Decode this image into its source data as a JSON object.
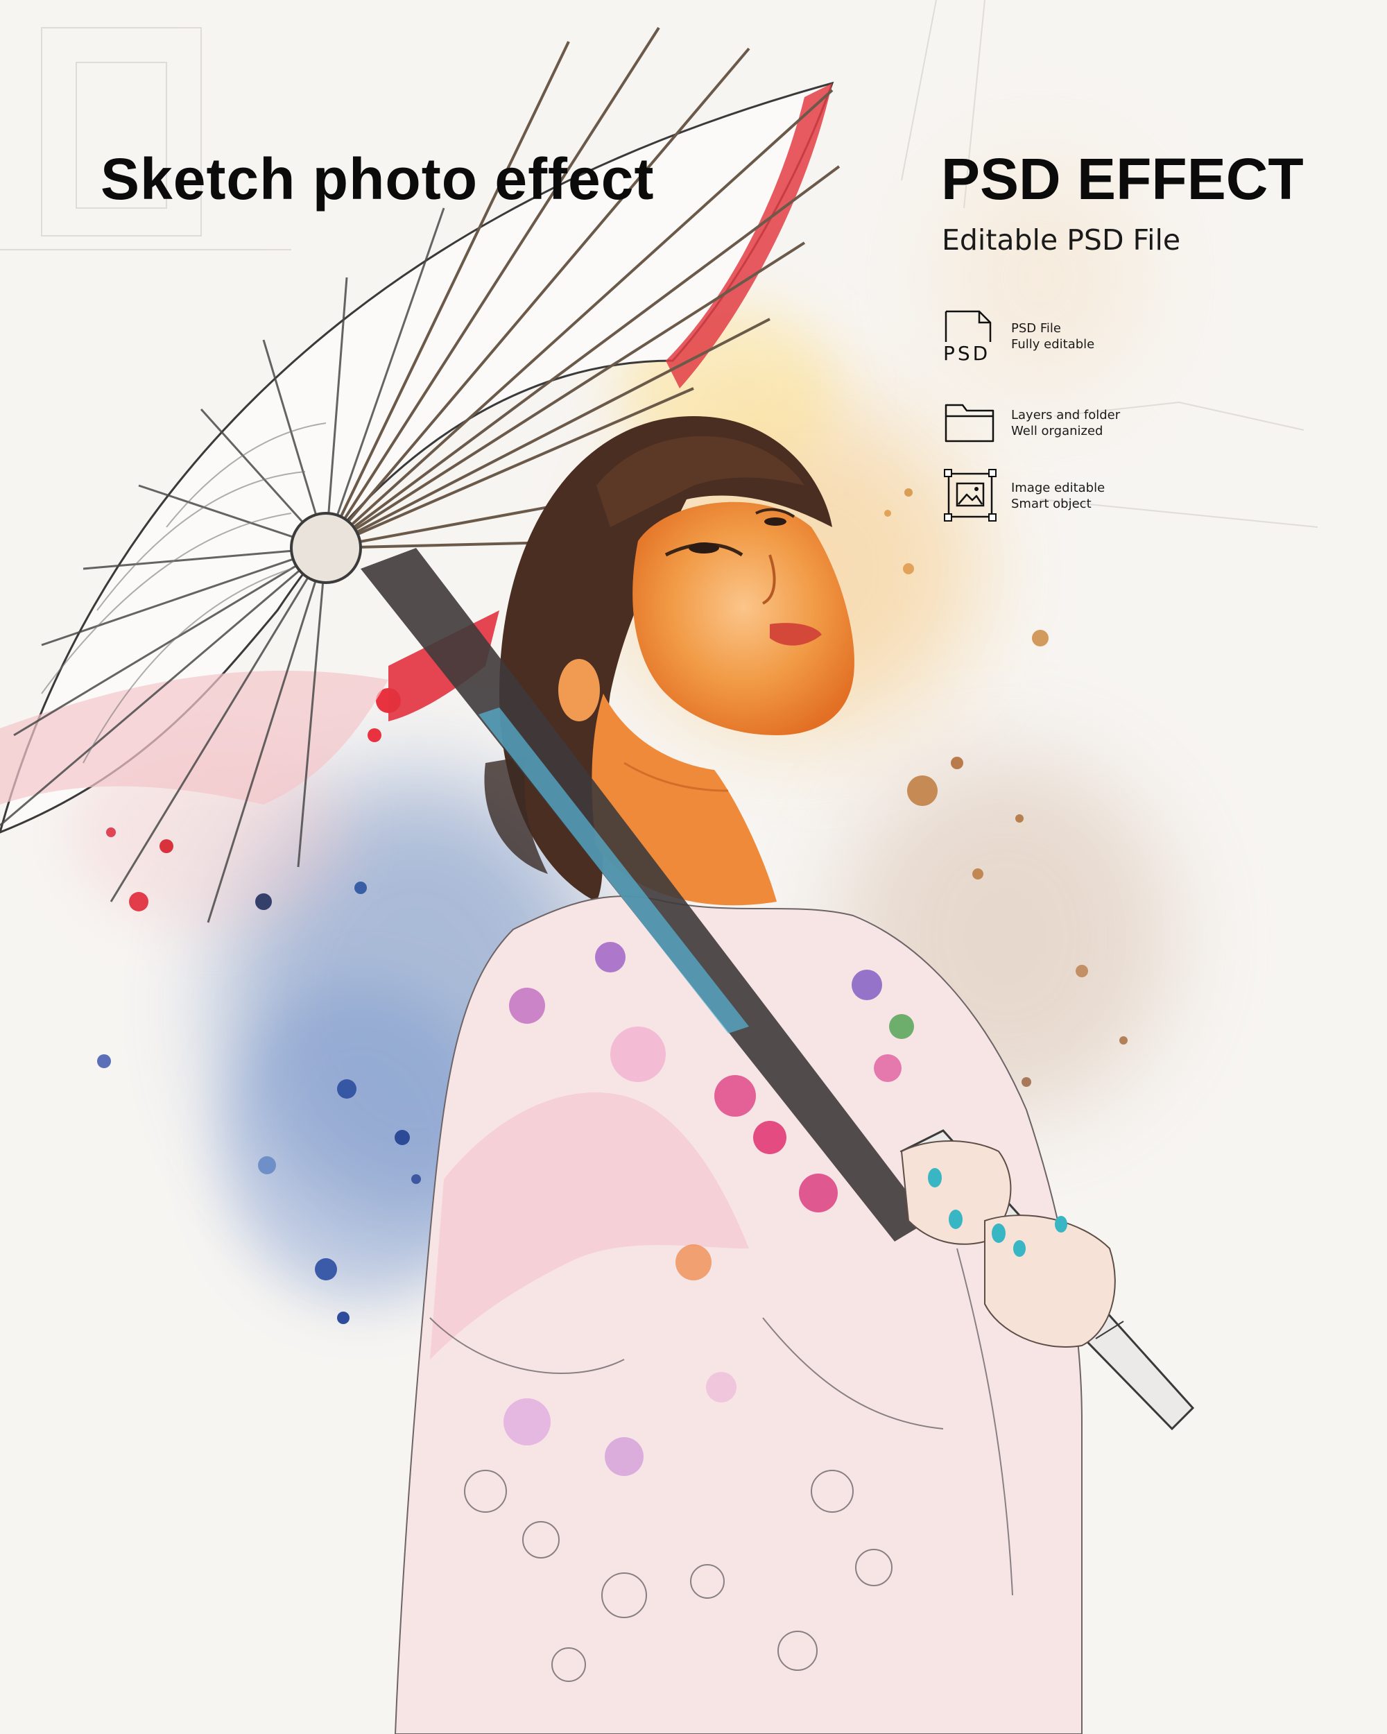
{
  "title": "Sketch photo effect",
  "badge": {
    "heading": "PSD EFFECT",
    "subheading": "Editable PSD File"
  },
  "features": [
    {
      "icon": "psd-file-icon",
      "icon_text": "PSD",
      "line1": "PSD File",
      "line2": "Fully editable"
    },
    {
      "icon": "folder-icon",
      "line1": "Layers and folder",
      "line2": "Well organized"
    },
    {
      "icon": "image-frame-icon",
      "line1": "Image editable",
      "line2": "Smart object"
    }
  ],
  "colors": {
    "text": "#0b0b0b",
    "background": "#f7f5f2",
    "umbrella_red": "#e0363c",
    "skin_orange": "#f08a2c",
    "splash_blue": "#3f63a8",
    "kimono_pink": "#f2d2d6",
    "hair_brown": "#4a2e22"
  }
}
